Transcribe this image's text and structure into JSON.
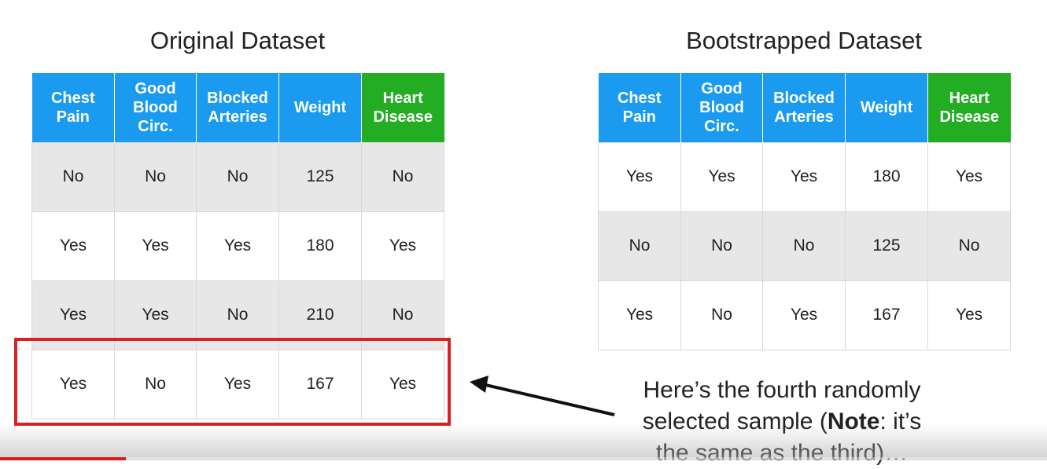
{
  "left_table": {
    "title": "Original Dataset",
    "headers": [
      "Chest Pain",
      "Good Blood Circ.",
      "Blocked Arteries",
      "Weight",
      "Heart Disease"
    ],
    "rows": [
      [
        "No",
        "No",
        "No",
        "125",
        "No"
      ],
      [
        "Yes",
        "Yes",
        "Yes",
        "180",
        "Yes"
      ],
      [
        "Yes",
        "Yes",
        "No",
        "210",
        "No"
      ],
      [
        "Yes",
        "No",
        "Yes",
        "167",
        "Yes"
      ]
    ],
    "highlighted_row": 3
  },
  "right_table": {
    "title": "Bootstrapped Dataset",
    "headers": [
      "Chest Pain",
      "Good Blood Circ.",
      "Blocked Arteries",
      "Weight",
      "Heart Disease"
    ],
    "rows": [
      [
        "Yes",
        "Yes",
        "Yes",
        "180",
        "Yes"
      ],
      [
        "No",
        "No",
        "No",
        "125",
        "No"
      ],
      [
        "Yes",
        "No",
        "Yes",
        "167",
        "Yes"
      ]
    ]
  },
  "annotation": {
    "line1": "Here’s the fourth randomly",
    "line2_prefix": "selected sample (",
    "note_bold": "Note",
    "line2_suffix": ": it’s",
    "line3": "the same as the third)…"
  },
  "video_progress": 0.12,
  "colors": {
    "header_blue": "#1a9bf0",
    "header_green": "#22ad22",
    "highlight_red": "#d62222",
    "row_shade": "#e7e7e7",
    "progress_red": "#e01818"
  }
}
